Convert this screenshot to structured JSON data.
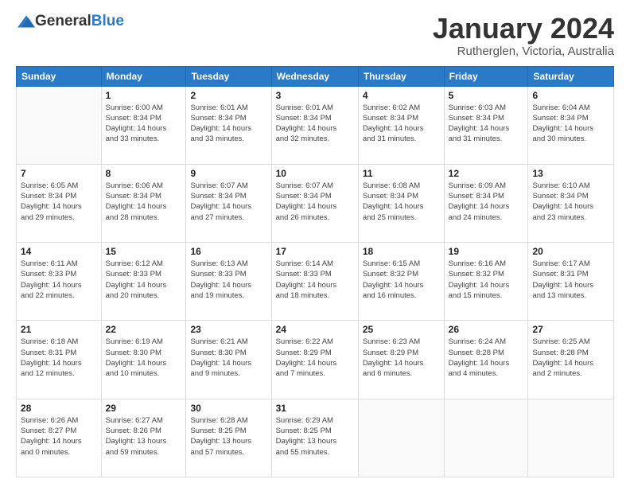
{
  "header": {
    "logo_general": "General",
    "logo_blue": "Blue",
    "month_title": "January 2024",
    "subtitle": "Rutherglen, Victoria, Australia"
  },
  "weekdays": [
    "Sunday",
    "Monday",
    "Tuesday",
    "Wednesday",
    "Thursday",
    "Friday",
    "Saturday"
  ],
  "weeks": [
    [
      {
        "day": "",
        "info": ""
      },
      {
        "day": "1",
        "info": "Sunrise: 6:00 AM\nSunset: 8:34 PM\nDaylight: 14 hours\nand 33 minutes."
      },
      {
        "day": "2",
        "info": "Sunrise: 6:01 AM\nSunset: 8:34 PM\nDaylight: 14 hours\nand 33 minutes."
      },
      {
        "day": "3",
        "info": "Sunrise: 6:01 AM\nSunset: 8:34 PM\nDaylight: 14 hours\nand 32 minutes."
      },
      {
        "day": "4",
        "info": "Sunrise: 6:02 AM\nSunset: 8:34 PM\nDaylight: 14 hours\nand 31 minutes."
      },
      {
        "day": "5",
        "info": "Sunrise: 6:03 AM\nSunset: 8:34 PM\nDaylight: 14 hours\nand 31 minutes."
      },
      {
        "day": "6",
        "info": "Sunrise: 6:04 AM\nSunset: 8:34 PM\nDaylight: 14 hours\nand 30 minutes."
      }
    ],
    [
      {
        "day": "7",
        "info": "Sunrise: 6:05 AM\nSunset: 8:34 PM\nDaylight: 14 hours\nand 29 minutes."
      },
      {
        "day": "8",
        "info": "Sunrise: 6:06 AM\nSunset: 8:34 PM\nDaylight: 14 hours\nand 28 minutes."
      },
      {
        "day": "9",
        "info": "Sunrise: 6:07 AM\nSunset: 8:34 PM\nDaylight: 14 hours\nand 27 minutes."
      },
      {
        "day": "10",
        "info": "Sunrise: 6:07 AM\nSunset: 8:34 PM\nDaylight: 14 hours\nand 26 minutes."
      },
      {
        "day": "11",
        "info": "Sunrise: 6:08 AM\nSunset: 8:34 PM\nDaylight: 14 hours\nand 25 minutes."
      },
      {
        "day": "12",
        "info": "Sunrise: 6:09 AM\nSunset: 8:34 PM\nDaylight: 14 hours\nand 24 minutes."
      },
      {
        "day": "13",
        "info": "Sunrise: 6:10 AM\nSunset: 8:34 PM\nDaylight: 14 hours\nand 23 minutes."
      }
    ],
    [
      {
        "day": "14",
        "info": "Sunrise: 6:11 AM\nSunset: 8:33 PM\nDaylight: 14 hours\nand 22 minutes."
      },
      {
        "day": "15",
        "info": "Sunrise: 6:12 AM\nSunset: 8:33 PM\nDaylight: 14 hours\nand 20 minutes."
      },
      {
        "day": "16",
        "info": "Sunrise: 6:13 AM\nSunset: 8:33 PM\nDaylight: 14 hours\nand 19 minutes."
      },
      {
        "day": "17",
        "info": "Sunrise: 6:14 AM\nSunset: 8:33 PM\nDaylight: 14 hours\nand 18 minutes."
      },
      {
        "day": "18",
        "info": "Sunrise: 6:15 AM\nSunset: 8:32 PM\nDaylight: 14 hours\nand 16 minutes."
      },
      {
        "day": "19",
        "info": "Sunrise: 6:16 AM\nSunset: 8:32 PM\nDaylight: 14 hours\nand 15 minutes."
      },
      {
        "day": "20",
        "info": "Sunrise: 6:17 AM\nSunset: 8:31 PM\nDaylight: 14 hours\nand 13 minutes."
      }
    ],
    [
      {
        "day": "21",
        "info": "Sunrise: 6:18 AM\nSunset: 8:31 PM\nDaylight: 14 hours\nand 12 minutes."
      },
      {
        "day": "22",
        "info": "Sunrise: 6:19 AM\nSunset: 8:30 PM\nDaylight: 14 hours\nand 10 minutes."
      },
      {
        "day": "23",
        "info": "Sunrise: 6:21 AM\nSunset: 8:30 PM\nDaylight: 14 hours\nand 9 minutes."
      },
      {
        "day": "24",
        "info": "Sunrise: 6:22 AM\nSunset: 8:29 PM\nDaylight: 14 hours\nand 7 minutes."
      },
      {
        "day": "25",
        "info": "Sunrise: 6:23 AM\nSunset: 8:29 PM\nDaylight: 14 hours\nand 6 minutes."
      },
      {
        "day": "26",
        "info": "Sunrise: 6:24 AM\nSunset: 8:28 PM\nDaylight: 14 hours\nand 4 minutes."
      },
      {
        "day": "27",
        "info": "Sunrise: 6:25 AM\nSunset: 8:28 PM\nDaylight: 14 hours\nand 2 minutes."
      }
    ],
    [
      {
        "day": "28",
        "info": "Sunrise: 6:26 AM\nSunset: 8:27 PM\nDaylight: 14 hours\nand 0 minutes."
      },
      {
        "day": "29",
        "info": "Sunrise: 6:27 AM\nSunset: 8:26 PM\nDaylight: 13 hours\nand 59 minutes."
      },
      {
        "day": "30",
        "info": "Sunrise: 6:28 AM\nSunset: 8:25 PM\nDaylight: 13 hours\nand 57 minutes."
      },
      {
        "day": "31",
        "info": "Sunrise: 6:29 AM\nSunset: 8:25 PM\nDaylight: 13 hours\nand 55 minutes."
      },
      {
        "day": "",
        "info": ""
      },
      {
        "day": "",
        "info": ""
      },
      {
        "day": "",
        "info": ""
      }
    ]
  ]
}
